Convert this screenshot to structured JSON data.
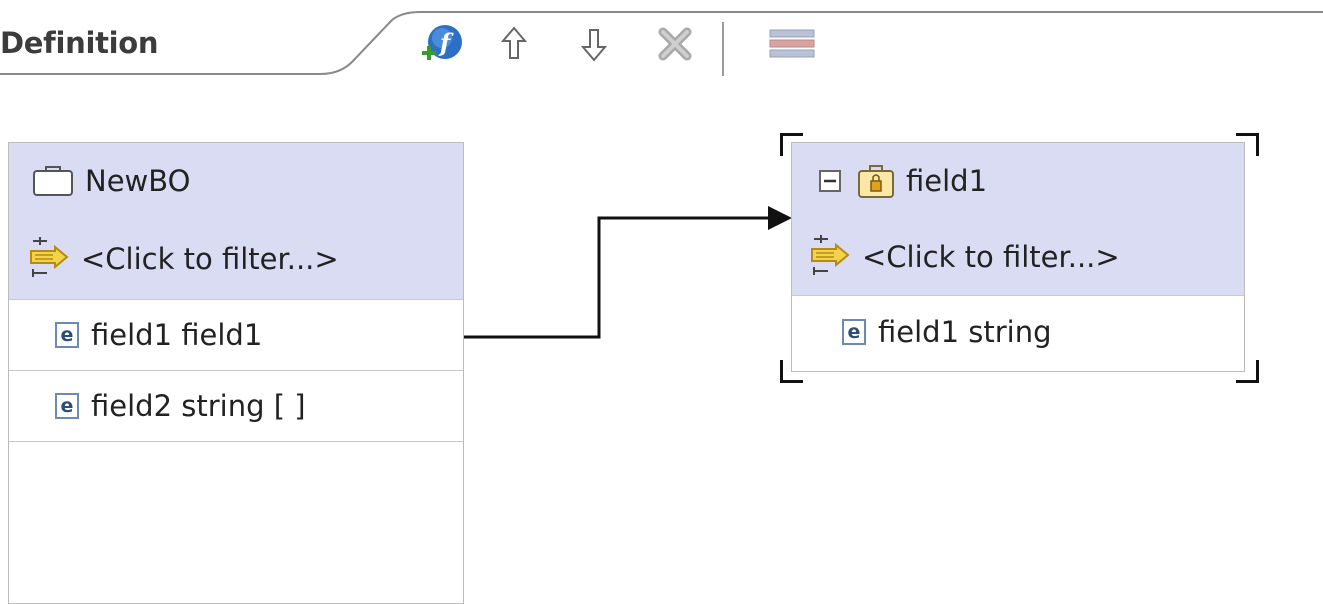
{
  "header": {
    "tab_title": "Definition"
  },
  "toolbar": {
    "items": [
      {
        "name": "add-field",
        "icon": "add-field-icon"
      },
      {
        "name": "move-up",
        "icon": "arrow-up-icon"
      },
      {
        "name": "move-down",
        "icon": "arrow-down-icon"
      },
      {
        "name": "delete",
        "icon": "delete-icon"
      },
      {
        "name": "layout",
        "icon": "layout-rows-icon"
      }
    ]
  },
  "left_bo": {
    "title": "NewBO",
    "icon": "business-object-icon",
    "filter": "<Click to filter...>",
    "fields": [
      {
        "badge": "e",
        "label": "field1 field1"
      },
      {
        "badge": "e",
        "label": "field2 string [ ]"
      }
    ]
  },
  "right_bo": {
    "title": "field1",
    "icon": "locked-business-object-icon",
    "collapse_icon": "collapse-icon",
    "filter": "<Click to filter...>",
    "fields": [
      {
        "badge": "e",
        "label": "field1 string"
      }
    ]
  },
  "colors": {
    "header_bg": "#d9dcf3",
    "border": "#bcbcbc",
    "connector": "#111111"
  }
}
